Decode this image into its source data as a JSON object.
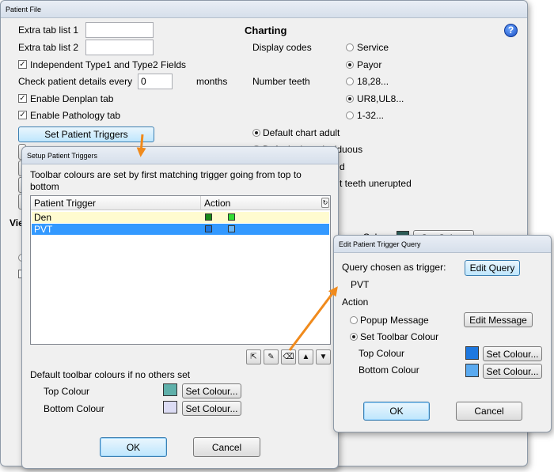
{
  "main_window": {
    "title": "Patient File",
    "extra_tab_1_label": "Extra tab list 1",
    "extra_tab_2_label": "Extra tab list 2",
    "extra_tab_1_value": "",
    "extra_tab_2_value": "",
    "independent_fields_label": "Independent Type1 and Type2 Fields",
    "check_details_label": "Check patient details every",
    "check_details_value": "0",
    "months_label": "months",
    "denplan_label": "Enable Denplan tab",
    "pathology_label": "Enable Pathology tab",
    "set_triggers_button": "Set Patient Triggers",
    "vi_fragment": "Vie",
    "charting": {
      "heading": "Charting",
      "display_codes_label": "Display codes",
      "service_label": "Service",
      "payor_label": "Payor",
      "number_teeth_label": "Number teeth",
      "teeth_opt1": "18,28...",
      "teeth_opt2": "UR8,UL8...",
      "teeth_opt3": "1-32...",
      "default_adult_label": "Default chart adult",
      "deciduous_fragment": "Default chart deciduous",
      "d_fragment": "d",
      "unerupted_fragment": "t teeth unerupted",
      "colour_fragment": "r Colour",
      "set_colour_fragment": "Set Colour"
    },
    "help_icon": "question-mark-icon"
  },
  "triggers_dialog": {
    "title": "Setup Patient Triggers",
    "description": "Toolbar colours are set by first matching trigger going from top to bottom",
    "columns": [
      "Patient Trigger",
      "Action"
    ],
    "rows": [
      {
        "trigger": "Den",
        "color1": "#1a8a1a",
        "color2": "#33dd33"
      },
      {
        "trigger": "PVT",
        "color1": "#1e78e0",
        "color2": "#6ab6f5"
      }
    ],
    "default_colours_label": "Default toolbar colours if no others set",
    "top_colour_label": "Top Colour",
    "bottom_colour_label": "Bottom Colour",
    "top_colour_value": "#5fb0aa",
    "bottom_colour_value": "#dcdcf4",
    "set_colour_button": "Set Colour...",
    "ok_button": "OK",
    "cancel_button": "Cancel"
  },
  "query_dialog": {
    "title": "Edit Patient Trigger Query",
    "query_label": "Query chosen as trigger:",
    "query_value": "PVT",
    "edit_query_button": "Edit Query",
    "action_label": "Action",
    "popup_label": "Popup Message",
    "edit_message_button": "Edit Message",
    "set_toolbar_label": "Set Toolbar Colour",
    "top_colour_label": "Top Colour",
    "bottom_colour_label": "Bottom Colour",
    "top_colour_value": "#1e78e0",
    "bottom_colour_value": "#5aaaf0",
    "set_colour_button": "Set Colour...",
    "ok_button": "OK",
    "cancel_button": "Cancel"
  },
  "colors": {
    "selection": "#3399ff",
    "arrow": "#f08a1c",
    "highlight_row": "#fffbd0"
  }
}
